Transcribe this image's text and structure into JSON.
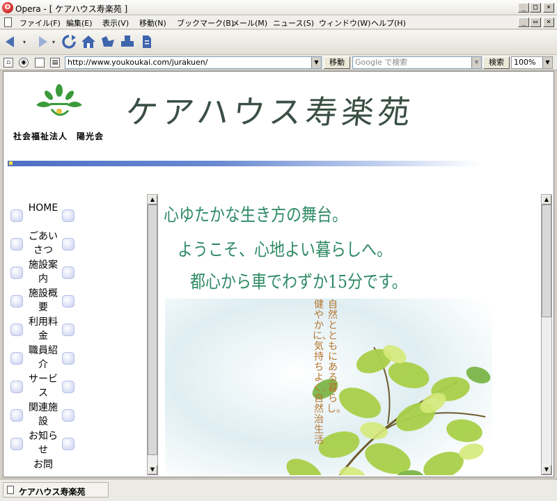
{
  "window": {
    "app_icon_glyph": "O",
    "title": "Opera - [ ケアハウス寿楽苑 ]",
    "minimize_glyph": "_",
    "restore_glyph": "□",
    "close_glyph": "×"
  },
  "menu": {
    "items": [
      "ファイル(F)",
      "編集(E)",
      "表示(V)",
      "移動(N)",
      "ブックマーク(B)",
      "メール(M)",
      "ニュース(S)",
      "ウィンドウ(W)",
      "ヘルプ(H)"
    ],
    "doc_minimize": "_",
    "doc_restore": "▭",
    "doc_close": "×"
  },
  "toolbar": {
    "icons": [
      "back-arrow-icon",
      "forward-arrow-icon",
      "reload-icon",
      "home-icon",
      "hotlist-icon",
      "print-icon",
      "document-icon"
    ]
  },
  "address": {
    "url": "http://www.youkoukai.com/jurakuen/",
    "go_label": "移動",
    "search_placeholder": "Google で検索",
    "search_label": "検索",
    "zoom": "100%"
  },
  "page": {
    "org_name": "社会福祉法人　陽光会",
    "site_title": "ケアハウス寿楽苑",
    "nav": [
      {
        "label": "HOME"
      },
      {
        "label": "ごあいさつ"
      },
      {
        "label": "施設案内"
      },
      {
        "label": "施設概要"
      },
      {
        "label": "利用料金"
      },
      {
        "label": "職員紹介"
      },
      {
        "label": "サービス"
      },
      {
        "label": "関連施設"
      },
      {
        "label": "お知らせ"
      },
      {
        "label": "お問"
      }
    ],
    "slogans": [
      "心ゆたかな生き方の舞台。",
      "ようこそ、心地よい暮らしへ。",
      "都心から車でわずか15分です。"
    ],
    "vertical_text": [
      "自然とともにある暮らし。",
      "健やかに、気持ちよく、自然治生活"
    ],
    "colors": {
      "slogan": "#2f8a66",
      "title": "#3b4f44",
      "header_bar": "#4e6fc4",
      "vertical_text": "#b4752f"
    }
  },
  "status": {
    "text": "ケアハウス寿楽苑"
  }
}
